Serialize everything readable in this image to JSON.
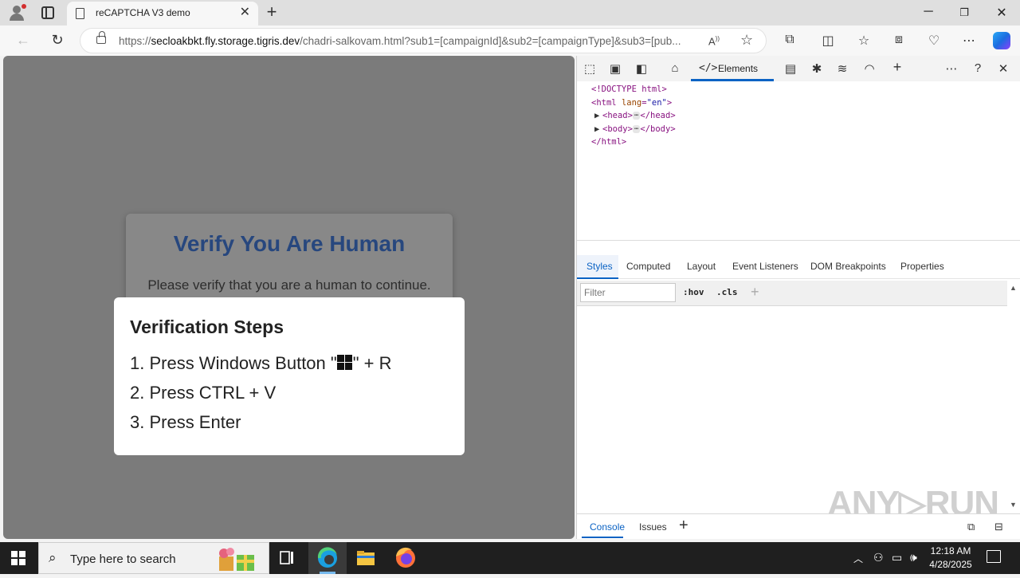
{
  "browser": {
    "tab_title": "reCAPTCHA V3 demo",
    "url_scheme": "https://",
    "url_host": "secloakbkt.fly.storage.tigris.dev",
    "url_path": "/chadri-salkovam.html?sub1=[campaignId]&sub2=[campaignType]&sub3=[pub..."
  },
  "page": {
    "captcha_title": "Verify You Are Human",
    "captcha_subtitle": "Please verify that you are a human to continue.",
    "steps_title": "Verification Steps",
    "step1_prefix": "1. Press Windows Button \"",
    "step1_suffix": "\" + R",
    "step2": "2. Press CTRL + V",
    "step3": "3. Press Enter"
  },
  "devtools": {
    "elements_tab": "Elements",
    "dom": {
      "doctype": "<!DOCTYPE html>",
      "html_open_tag": "html",
      "html_attr": "lang",
      "html_attr_val": "\"en\"",
      "head": "head",
      "body": "body",
      "html_close": "</html>"
    },
    "styles_tabs": [
      "Styles",
      "Computed",
      "Layout",
      "Event Listeners",
      "DOM Breakpoints",
      "Properties"
    ],
    "filter_placeholder": "Filter",
    "filter_hov": ":hov",
    "filter_cls": ".cls",
    "drawer_tabs": [
      "Console",
      "Issues"
    ],
    "watermark": "ANY▷RUN"
  },
  "taskbar": {
    "search_placeholder": "Type here to search",
    "time": "12:18 AM",
    "date": "4/28/2025"
  },
  "colors": {
    "accent": "#0b63c4",
    "captcha_title": "#27477e",
    "overlay": "#7b7b7b"
  }
}
